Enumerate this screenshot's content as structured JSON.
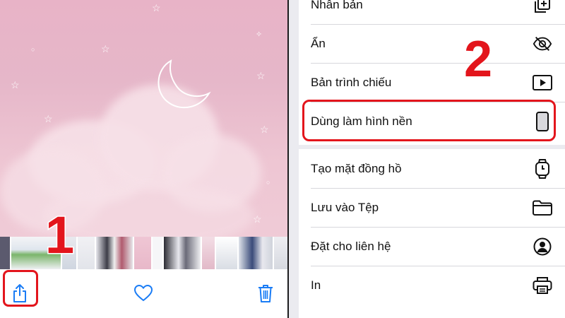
{
  "left": {
    "toolbar": {
      "share_icon": "share-icon",
      "favorite_icon": "heart-icon",
      "delete_icon": "trash-icon"
    },
    "step_label": "1"
  },
  "right": {
    "menu_top": [
      {
        "label": "Nhân bản",
        "icon": "duplicate-icon"
      },
      {
        "label": "Ẩn",
        "icon": "eye-slash-icon"
      },
      {
        "label": "Bản trình chiếu",
        "icon": "play-icon"
      },
      {
        "label": "Dùng làm hình nền",
        "icon": "phone-icon"
      }
    ],
    "menu_bottom": [
      {
        "label": "Tạo mặt đồng hồ",
        "icon": "watch-icon"
      },
      {
        "label": "Lưu vào Tệp",
        "icon": "folder-icon"
      },
      {
        "label": "Đặt cho liên hệ",
        "icon": "contact-icon"
      },
      {
        "label": "In",
        "icon": "printer-icon"
      }
    ],
    "step_label": "2"
  },
  "colors": {
    "highlight": "#e3151c",
    "accent": "#1a7cf5",
    "sheet_bg": "#ebebf0"
  }
}
